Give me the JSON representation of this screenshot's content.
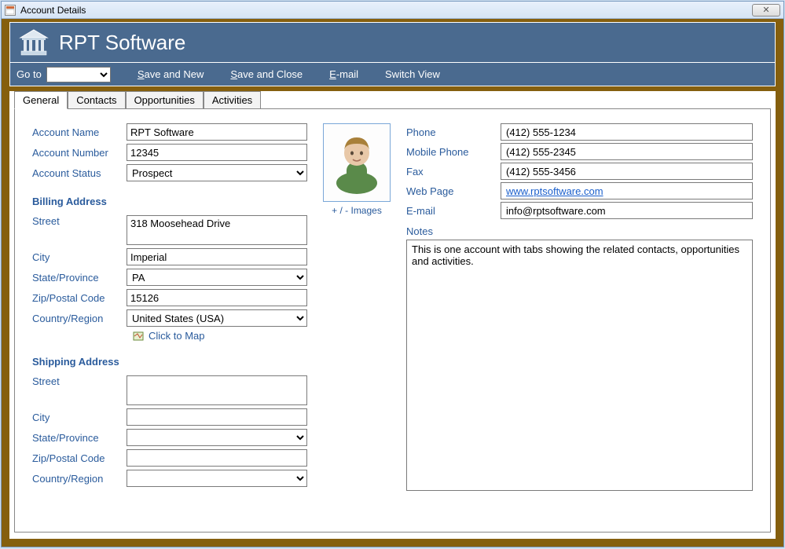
{
  "window": {
    "title": "Account Details"
  },
  "header": {
    "title": "RPT Software"
  },
  "toolbar": {
    "goto_label": "Go to",
    "save_and_new": "Save and New",
    "save_and_close": "Save and Close",
    "email": "E-mail",
    "switch_view": "Switch View"
  },
  "tabs": {
    "general": "General",
    "contacts": "Contacts",
    "opportunities": "Opportunities",
    "activities": "Activities"
  },
  "labels": {
    "account_name": "Account Name",
    "account_number": "Account Number",
    "account_status": "Account Status",
    "billing_address": "Billing Address",
    "shipping_address": "Shipping Address",
    "street": "Street",
    "city": "City",
    "state": "State/Province",
    "zip": "Zip/Postal Code",
    "country": "Country/Region",
    "click_to_map": "Click to Map",
    "images_link": "+ / -  Images",
    "phone": "Phone",
    "mobile": "Mobile Phone",
    "fax": "Fax",
    "webpage": "Web Page",
    "email": "E-mail",
    "notes": "Notes"
  },
  "account": {
    "name": "RPT Software",
    "number": "12345",
    "status": "Prospect",
    "billing": {
      "street": "318 Moosehead Drive",
      "city": "Imperial",
      "state": "PA",
      "zip": "15126",
      "country": "United States (USA)"
    },
    "shipping": {
      "street": "",
      "city": "",
      "state": "",
      "zip": "",
      "country": ""
    },
    "contact": {
      "phone": "(412) 555-1234",
      "mobile": "(412) 555-2345",
      "fax": "(412) 555-3456",
      "webpage": "www.rptsoftware.com",
      "email": "info@rptsoftware.com"
    },
    "notes": "This is one account with tabs showing the related contacts, opportunities and activities."
  }
}
